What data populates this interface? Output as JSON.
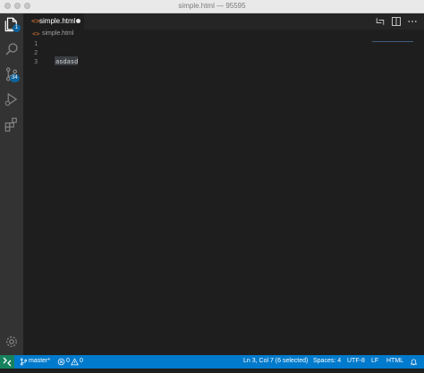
{
  "window": {
    "title": "simple.html — 95595"
  },
  "activity_bar": {
    "items": [
      {
        "name": "explorer",
        "icon": "files-icon",
        "badge": "1"
      },
      {
        "name": "search",
        "icon": "search-icon"
      },
      {
        "name": "source-control",
        "icon": "source-control-icon",
        "badge": "34"
      },
      {
        "name": "run",
        "icon": "run-debug-icon"
      },
      {
        "name": "extensions",
        "icon": "extensions-icon"
      }
    ],
    "manage_icon": "gear-icon"
  },
  "tab": {
    "label": "simple.html",
    "modified": true,
    "icon": "html-file-icon"
  },
  "breadcrumb": {
    "label": "simple.html",
    "icon": "html-file-icon"
  },
  "editor": {
    "lines": [
      {
        "number": "1",
        "text": ""
      },
      {
        "number": "2",
        "text": ""
      },
      {
        "number": "3",
        "text": "asdasd"
      }
    ]
  },
  "statusbar": {
    "branch": "master*",
    "errors": "0",
    "warnings": "0",
    "cursor": "Ln 3, Col 7 (6 selected)",
    "spaces": "Spaces: 4",
    "encoding": "UTF-8",
    "eol": "LF",
    "language": "HTML"
  },
  "colors": {
    "activity_bar": "#333333",
    "editor_bg": "#1e1e1e",
    "status_bar": "#007acc",
    "remote_indicator": "#16825d",
    "html_icon": "#e37933"
  }
}
